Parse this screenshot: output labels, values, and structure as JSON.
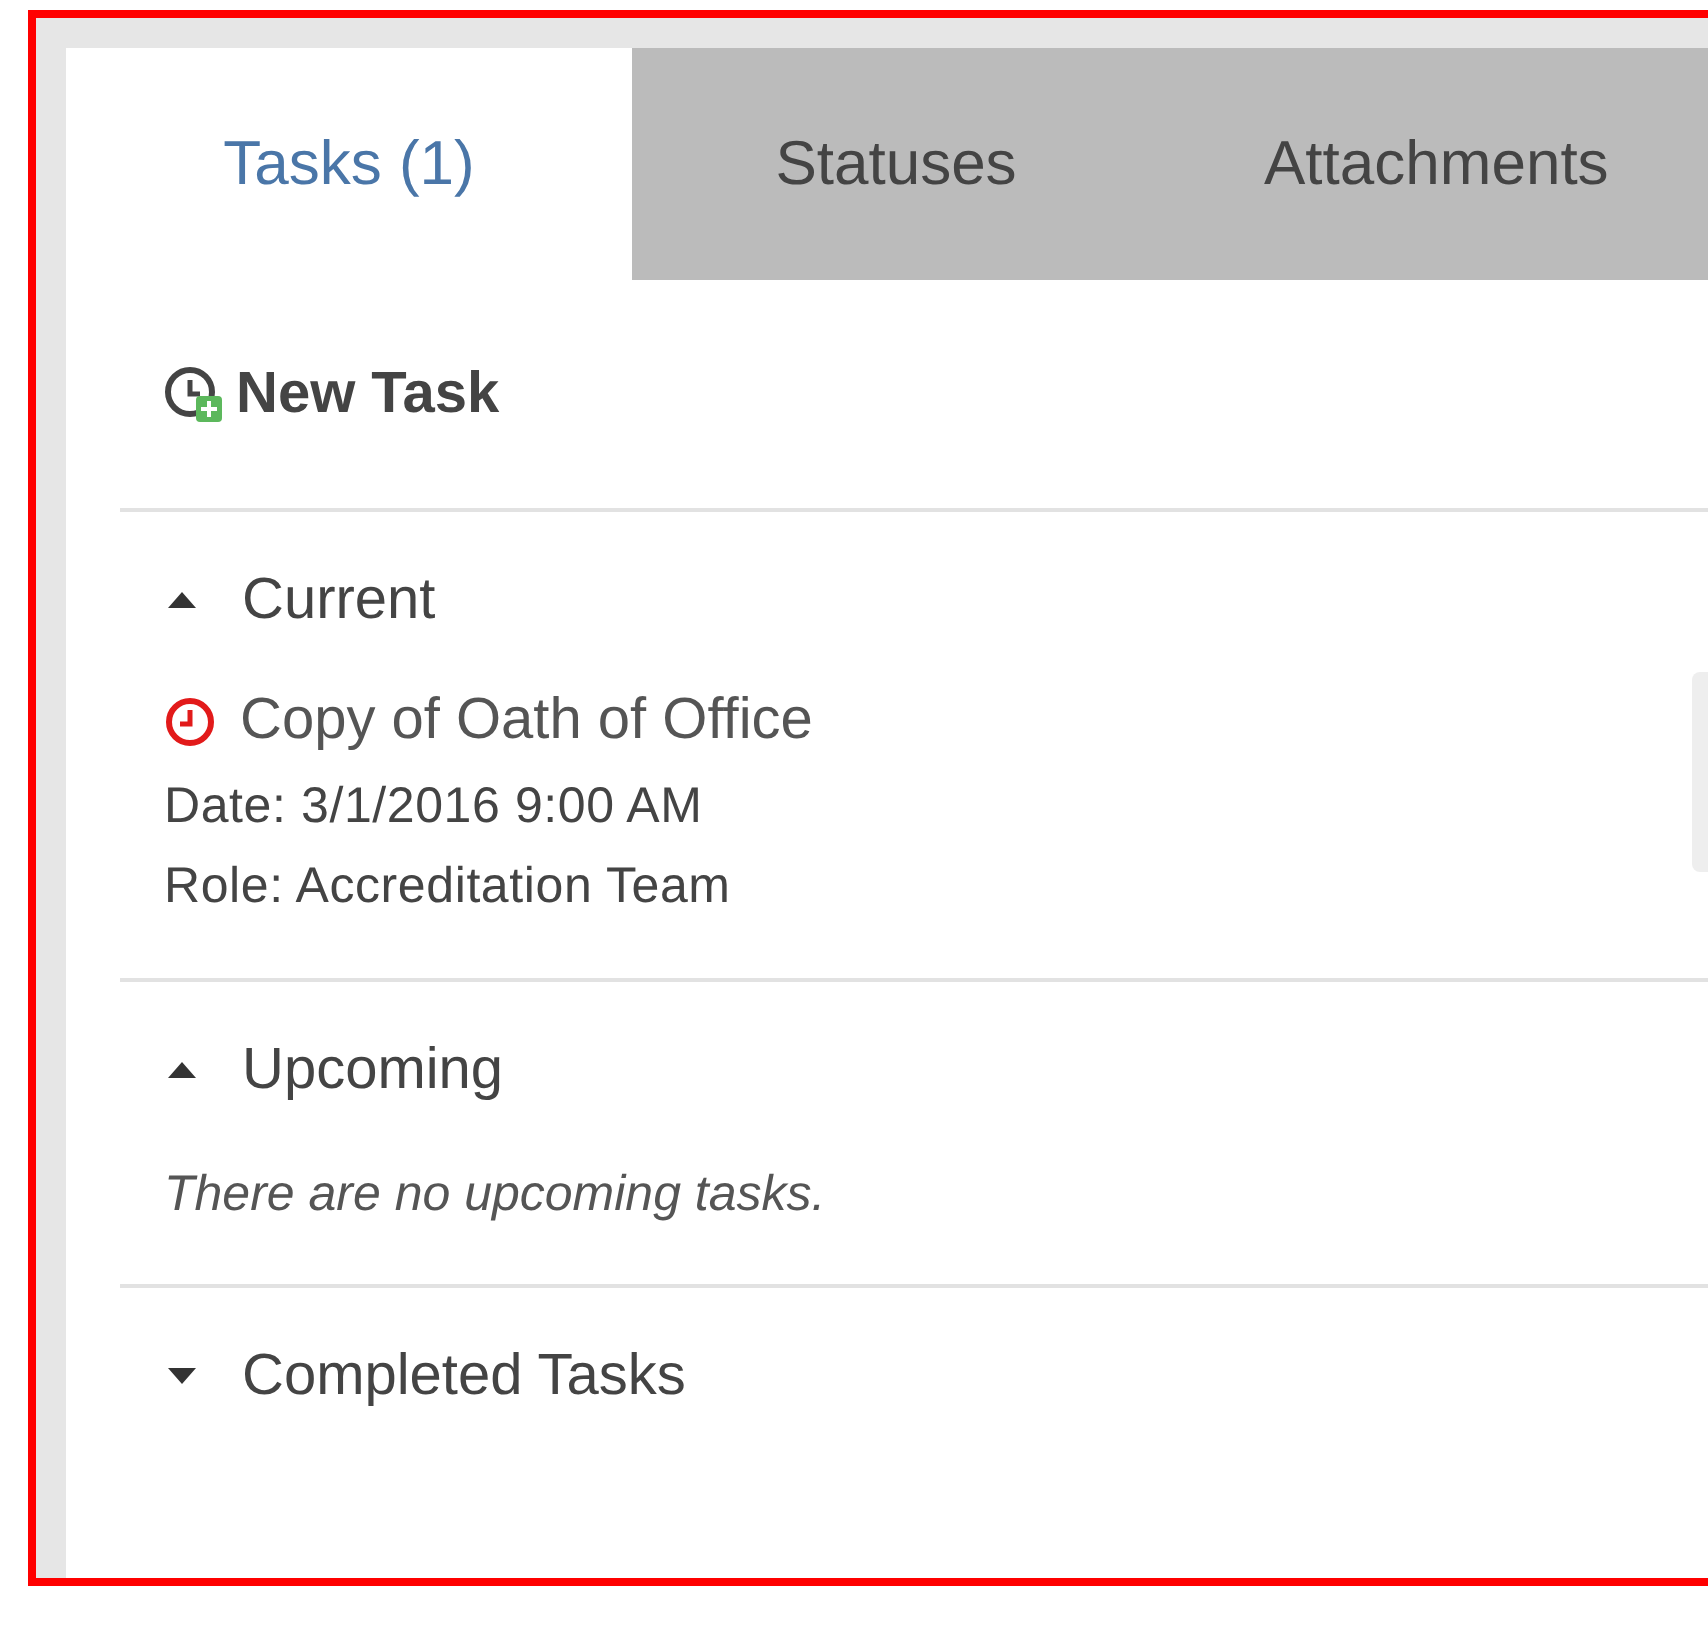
{
  "tabs": [
    {
      "label": "Tasks (1)",
      "selected": true
    },
    {
      "label": "Statuses",
      "selected": false
    },
    {
      "label": "Attachments",
      "selected": false
    }
  ],
  "new_task": {
    "label": "New Task"
  },
  "sections": [
    {
      "title": "Current",
      "expanded": true,
      "tasks": [
        {
          "title": "Copy of Oath of Office",
          "overdue": true,
          "date": "Date: 3/1/2016 9:00 AM",
          "role": "Role: Accreditation Team"
        }
      ]
    },
    {
      "title": "Upcoming",
      "expanded": true,
      "empty_message": "There are no upcoming tasks."
    },
    {
      "title": "Completed Tasks",
      "expanded": false
    }
  ]
}
